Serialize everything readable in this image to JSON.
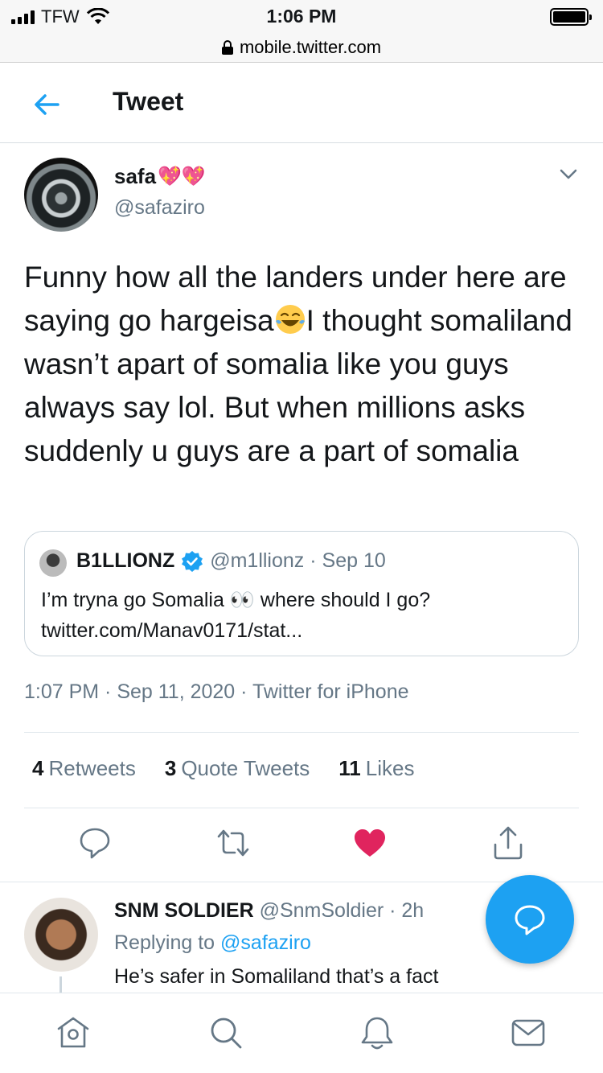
{
  "status_bar": {
    "carrier": "TFW",
    "time": "1:06 PM"
  },
  "url_bar": {
    "url": "mobile.twitter.com"
  },
  "header": {
    "title": "Tweet"
  },
  "tweet": {
    "author_name": "safa",
    "author_emoji": "💖💖",
    "author_handle": "@safaziro",
    "text_part1": "Funny how all the landers under here are saying go hargeisa",
    "text_emoji": "😂",
    "text_part2": "I thought somaliland wasn’t apart of somalia like you guys always say lol. But when millions asks suddenly u guys are a part of somalia",
    "timestamp": "1:07 PM · Sep 11, 2020 · Twitter for iPhone"
  },
  "quote": {
    "name": "B1LLIONZ",
    "handle_date": "@m1llionz · Sep 10",
    "text_line1": "I’m tryna go Somalia 👀 where should I go?",
    "text_line2": "twitter.com/Manav0171/stat..."
  },
  "stats": {
    "retweets_count": "4",
    "retweets_label": "Retweets",
    "quotes_count": "3",
    "quotes_label": "Quote Tweets",
    "likes_count": "11",
    "likes_label": "Likes"
  },
  "reply": {
    "name": "SNM SOLDIER",
    "handle_time": "@SnmSoldier · 2h",
    "replying_prefix": "Replying to",
    "replying_handle": "@safaziro",
    "text": "He’s safer in Somaliland that’s a fact"
  },
  "colors": {
    "accent": "#1da1f2",
    "like": "#e0245e",
    "muted": "#657786"
  },
  "icons": [
    "back-arrow-icon",
    "chevron-down-icon",
    "verified-icon",
    "reply-icon",
    "retweet-icon",
    "like-icon",
    "share-icon",
    "compose-icon",
    "home-icon",
    "search-icon",
    "notifications-icon",
    "messages-icon"
  ]
}
